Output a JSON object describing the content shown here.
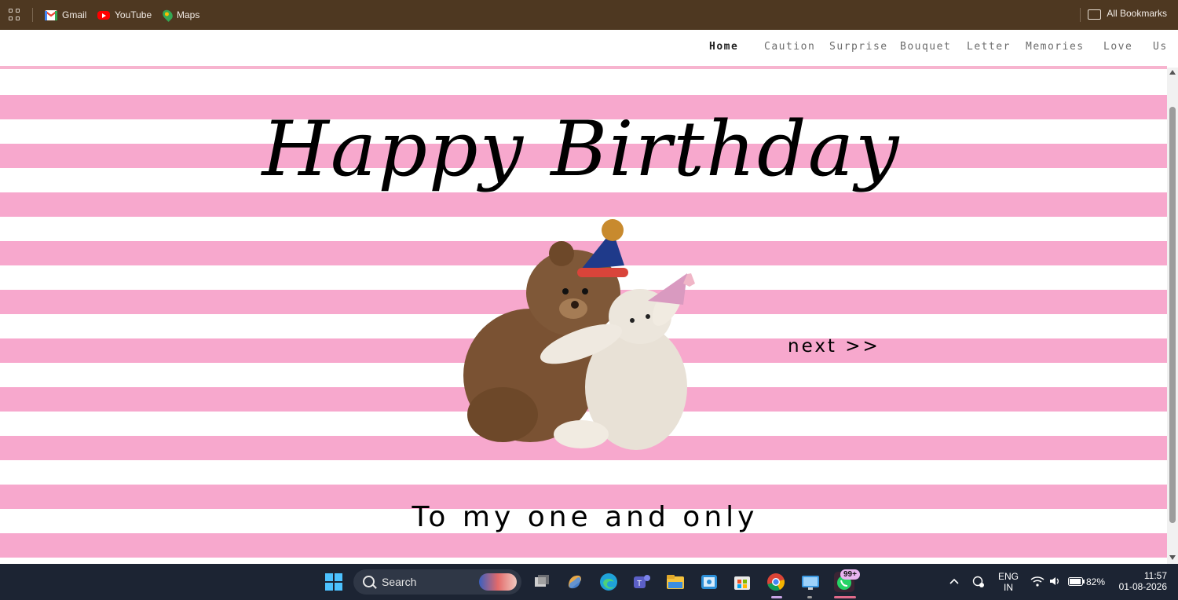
{
  "bookmarks_bar": {
    "items": [
      {
        "label": "Gmail"
      },
      {
        "label": "YouTube"
      },
      {
        "label": "Maps"
      }
    ],
    "all_bookmarks": "All Bookmarks"
  },
  "nav": {
    "links": [
      "Home",
      "Caution",
      "Surprise",
      "Bouquet",
      "Letter",
      "Memories",
      "Love",
      "Us"
    ],
    "active": "Home"
  },
  "hero": {
    "title": "Happy Birthday",
    "next": "next >>",
    "subtitle": "To my one and only"
  },
  "colors": {
    "stripe_pink": "#f7a8cd",
    "bookmarks_bg": "#4e3821",
    "taskbar_bg": "#1c2433"
  },
  "taskbar": {
    "search_label": "Search",
    "language": "ENG",
    "region": "IN",
    "battery": "82%",
    "time": "11:57",
    "date": "01-08-2026",
    "notification_badge": "99+"
  }
}
